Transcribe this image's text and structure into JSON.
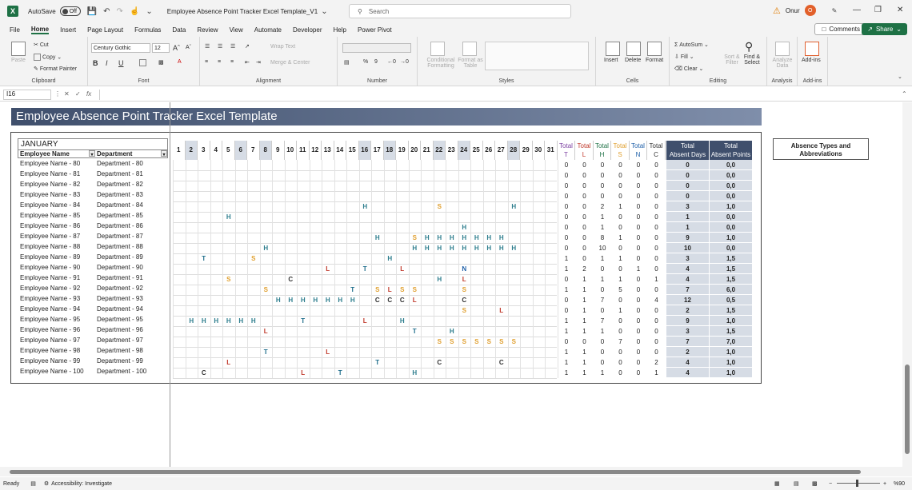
{
  "titlebar": {
    "autosave_label": "AutoSave",
    "autosave_state": "Off",
    "doc_title": "Employee Absence Point Tracker Excel Template_V1",
    "search_placeholder": "Search",
    "user_name": "Onur",
    "user_initial": "O"
  },
  "menu": {
    "items": [
      "File",
      "Home",
      "Insert",
      "Page Layout",
      "Formulas",
      "Data",
      "Review",
      "View",
      "Automate",
      "Developer",
      "Help",
      "Power Pivot"
    ],
    "active": "Home",
    "comments_label": "Comments",
    "share_label": "Share"
  },
  "ribbon": {
    "clipboard": {
      "paste": "Paste",
      "cut": "Cut",
      "copy": "Copy",
      "format_painter": "Format Painter",
      "label": "Clipboard"
    },
    "font": {
      "family": "Century Gothic",
      "size": "12",
      "bold": "B",
      "italic": "I",
      "underline": "U",
      "label": "Font"
    },
    "alignment": {
      "wrap": "Wrap Text",
      "merge": "Merge & Center",
      "label": "Alignment"
    },
    "number": {
      "label": "Number"
    },
    "styles": {
      "conditional": "Conditional Formatting",
      "format_table": "Format as Table",
      "label": "Styles"
    },
    "cells": {
      "insert": "Insert",
      "delete": "Delete",
      "format": "Format",
      "label": "Cells"
    },
    "editing": {
      "autosum": "AutoSum",
      "fill": "Fill",
      "clear": "Clear",
      "sort": "Sort & Filter",
      "find": "Find & Select",
      "label": "Editing"
    },
    "analysis": {
      "analyze": "Analyze Data",
      "label": "Analysis"
    },
    "addins": {
      "addins": "Add-ins",
      "label": "Add-ins"
    }
  },
  "formula_bar": {
    "cell_ref": "I16",
    "fx": "fx"
  },
  "sheet": {
    "title": "Employee Absence Point Tracker Excel Template",
    "month": "JANUARY",
    "col_employee": "Employee Name",
    "col_department": "Department",
    "abs_types_title": "Absence Types and Abbreviations",
    "days": [
      "1",
      "2",
      "3",
      "4",
      "5",
      "6",
      "7",
      "8",
      "9",
      "10",
      "11",
      "12",
      "13",
      "14",
      "15",
      "16",
      "17",
      "18",
      "19",
      "20",
      "21",
      "22",
      "23",
      "24",
      "25",
      "26",
      "27",
      "28",
      "29",
      "30",
      "31"
    ],
    "total_headers": [
      {
        "line1": "Total",
        "line2": "T"
      },
      {
        "line1": "Total",
        "line2": "L"
      },
      {
        "line1": "Total",
        "line2": "H"
      },
      {
        "line1": "Total",
        "line2": "S"
      },
      {
        "line1": "Total",
        "line2": "N"
      },
      {
        "line1": "Total",
        "line2": "C"
      }
    ],
    "sum_headers": [
      {
        "line1": "Total",
        "line2": "Absent Days"
      },
      {
        "line1": "Total",
        "line2": "Absent Points"
      }
    ],
    "rows": [
      {
        "name": "Employee Name - 80",
        "dept": "Department - 80",
        "marks": [],
        "totals": [
          "0",
          "0",
          "0",
          "0",
          "0",
          "0"
        ],
        "days": "0",
        "points": "0,0"
      },
      {
        "name": "Employee Name - 81",
        "dept": "Department - 81",
        "marks": [],
        "totals": [
          "0",
          "0",
          "0",
          "0",
          "0",
          "0"
        ],
        "days": "0",
        "points": "0,0"
      },
      {
        "name": "Employee Name - 82",
        "dept": "Department - 82",
        "marks": [],
        "totals": [
          "0",
          "0",
          "0",
          "0",
          "0",
          "0"
        ],
        "days": "0",
        "points": "0,0"
      },
      {
        "name": "Employee Name - 83",
        "dept": "Department - 83",
        "marks": [],
        "totals": [
          "0",
          "0",
          "0",
          "0",
          "0",
          "0"
        ],
        "days": "0",
        "points": "0,0"
      },
      {
        "name": "Employee Name - 84",
        "dept": "Department - 84",
        "marks": [
          [
            16,
            "H"
          ],
          [
            22,
            "S"
          ],
          [
            28,
            "H"
          ]
        ],
        "totals": [
          "0",
          "0",
          "2",
          "1",
          "0",
          "0"
        ],
        "days": "3",
        "points": "1,0"
      },
      {
        "name": "Employee Name - 85",
        "dept": "Department - 85",
        "marks": [
          [
            5,
            "H"
          ]
        ],
        "totals": [
          "0",
          "0",
          "1",
          "0",
          "0",
          "0"
        ],
        "days": "1",
        "points": "0,0"
      },
      {
        "name": "Employee Name - 86",
        "dept": "Department - 86",
        "marks": [
          [
            24,
            "H"
          ]
        ],
        "totals": [
          "0",
          "0",
          "1",
          "0",
          "0",
          "0"
        ],
        "days": "1",
        "points": "0,0"
      },
      {
        "name": "Employee Name - 87",
        "dept": "Department - 87",
        "marks": [
          [
            17,
            "H"
          ],
          [
            20,
            "S"
          ],
          [
            21,
            "H"
          ],
          [
            22,
            "H"
          ],
          [
            23,
            "H"
          ],
          [
            24,
            "H"
          ],
          [
            25,
            "H"
          ],
          [
            26,
            "H"
          ],
          [
            27,
            "H"
          ]
        ],
        "totals": [
          "0",
          "0",
          "8",
          "1",
          "0",
          "0"
        ],
        "days": "9",
        "points": "1,0"
      },
      {
        "name": "Employee Name - 88",
        "dept": "Department - 88",
        "marks": [
          [
            8,
            "H"
          ],
          [
            20,
            "H"
          ],
          [
            21,
            "H"
          ],
          [
            22,
            "H"
          ],
          [
            23,
            "H"
          ],
          [
            24,
            "H"
          ],
          [
            25,
            "H"
          ],
          [
            26,
            "H"
          ],
          [
            27,
            "H"
          ],
          [
            28,
            "H"
          ]
        ],
        "totals": [
          "0",
          "0",
          "10",
          "0",
          "0",
          "0"
        ],
        "days": "10",
        "points": "0,0"
      },
      {
        "name": "Employee Name - 89",
        "dept": "Department - 89",
        "marks": [
          [
            3,
            "T"
          ],
          [
            7,
            "S"
          ],
          [
            18,
            "H"
          ]
        ],
        "totals": [
          "1",
          "0",
          "1",
          "1",
          "0",
          "0"
        ],
        "days": "3",
        "points": "1,5"
      },
      {
        "name": "Employee Name - 90",
        "dept": "Department - 90",
        "marks": [
          [
            13,
            "L"
          ],
          [
            16,
            "T"
          ],
          [
            19,
            "L"
          ],
          [
            24,
            "N"
          ]
        ],
        "totals": [
          "1",
          "2",
          "0",
          "0",
          "1",
          "0"
        ],
        "days": "4",
        "points": "1,5"
      },
      {
        "name": "Employee Name - 91",
        "dept": "Department - 91",
        "marks": [
          [
            5,
            "S"
          ],
          [
            10,
            "C"
          ],
          [
            22,
            "H"
          ],
          [
            24,
            "L"
          ]
        ],
        "totals": [
          "0",
          "1",
          "1",
          "1",
          "0",
          "1"
        ],
        "days": "4",
        "points": "1,5"
      },
      {
        "name": "Employee Name - 92",
        "dept": "Department - 92",
        "marks": [
          [
            8,
            "S"
          ],
          [
            15,
            "T"
          ],
          [
            17,
            "S"
          ],
          [
            18,
            "L"
          ],
          [
            19,
            "S"
          ],
          [
            20,
            "S"
          ],
          [
            24,
            "S"
          ]
        ],
        "totals": [
          "1",
          "1",
          "0",
          "5",
          "0",
          "0"
        ],
        "days": "7",
        "points": "6,0"
      },
      {
        "name": "Employee Name - 93",
        "dept": "Department - 93",
        "marks": [
          [
            9,
            "H"
          ],
          [
            10,
            "H"
          ],
          [
            11,
            "H"
          ],
          [
            12,
            "H"
          ],
          [
            13,
            "H"
          ],
          [
            14,
            "H"
          ],
          [
            15,
            "H"
          ],
          [
            17,
            "C"
          ],
          [
            18,
            "C"
          ],
          [
            19,
            "C"
          ],
          [
            20,
            "L"
          ],
          [
            24,
            "C"
          ]
        ],
        "totals": [
          "0",
          "1",
          "7",
          "0",
          "0",
          "4"
        ],
        "days": "12",
        "points": "0,5"
      },
      {
        "name": "Employee Name - 94",
        "dept": "Department - 94",
        "marks": [
          [
            24,
            "S"
          ],
          [
            27,
            "L"
          ]
        ],
        "totals": [
          "0",
          "1",
          "0",
          "1",
          "0",
          "0"
        ],
        "days": "2",
        "points": "1,5"
      },
      {
        "name": "Employee Name - 95",
        "dept": "Department - 95",
        "marks": [
          [
            2,
            "H"
          ],
          [
            3,
            "H"
          ],
          [
            4,
            "H"
          ],
          [
            5,
            "H"
          ],
          [
            6,
            "H"
          ],
          [
            7,
            "H"
          ],
          [
            11,
            "T"
          ],
          [
            16,
            "L"
          ],
          [
            19,
            "H"
          ]
        ],
        "totals": [
          "1",
          "1",
          "7",
          "0",
          "0",
          "0"
        ],
        "days": "9",
        "points": "1,0"
      },
      {
        "name": "Employee Name - 96",
        "dept": "Department - 96",
        "marks": [
          [
            8,
            "L"
          ],
          [
            20,
            "T"
          ],
          [
            23,
            "H"
          ]
        ],
        "totals": [
          "1",
          "1",
          "1",
          "0",
          "0",
          "0"
        ],
        "days": "3",
        "points": "1,5"
      },
      {
        "name": "Employee Name - 97",
        "dept": "Department - 97",
        "marks": [
          [
            22,
            "S"
          ],
          [
            23,
            "S"
          ],
          [
            24,
            "S"
          ],
          [
            25,
            "S"
          ],
          [
            26,
            "S"
          ],
          [
            27,
            "S"
          ],
          [
            28,
            "S"
          ]
        ],
        "totals": [
          "0",
          "0",
          "0",
          "7",
          "0",
          "0"
        ],
        "days": "7",
        "points": "7,0"
      },
      {
        "name": "Employee Name - 98",
        "dept": "Department - 98",
        "marks": [
          [
            8,
            "T"
          ],
          [
            13,
            "L"
          ]
        ],
        "totals": [
          "1",
          "1",
          "0",
          "0",
          "0",
          "0"
        ],
        "days": "2",
        "points": "1,0"
      },
      {
        "name": "Employee Name - 99",
        "dept": "Department - 99",
        "marks": [
          [
            5,
            "L"
          ],
          [
            17,
            "T"
          ],
          [
            22,
            "C"
          ],
          [
            27,
            "C"
          ]
        ],
        "totals": [
          "1",
          "1",
          "0",
          "0",
          "0",
          "2"
        ],
        "days": "4",
        "points": "1,0"
      },
      {
        "name": "Employee Name - 100",
        "dept": "Department - 100",
        "marks": [
          [
            3,
            "C"
          ],
          [
            11,
            "L"
          ],
          [
            14,
            "T"
          ],
          [
            20,
            "H"
          ]
        ],
        "totals": [
          "1",
          "1",
          "1",
          "0",
          "0",
          "1"
        ],
        "days": "4",
        "points": "1,0"
      }
    ]
  },
  "status": {
    "ready": "Ready",
    "accessibility": "Accessibility: Investigate",
    "zoom": "%90"
  }
}
